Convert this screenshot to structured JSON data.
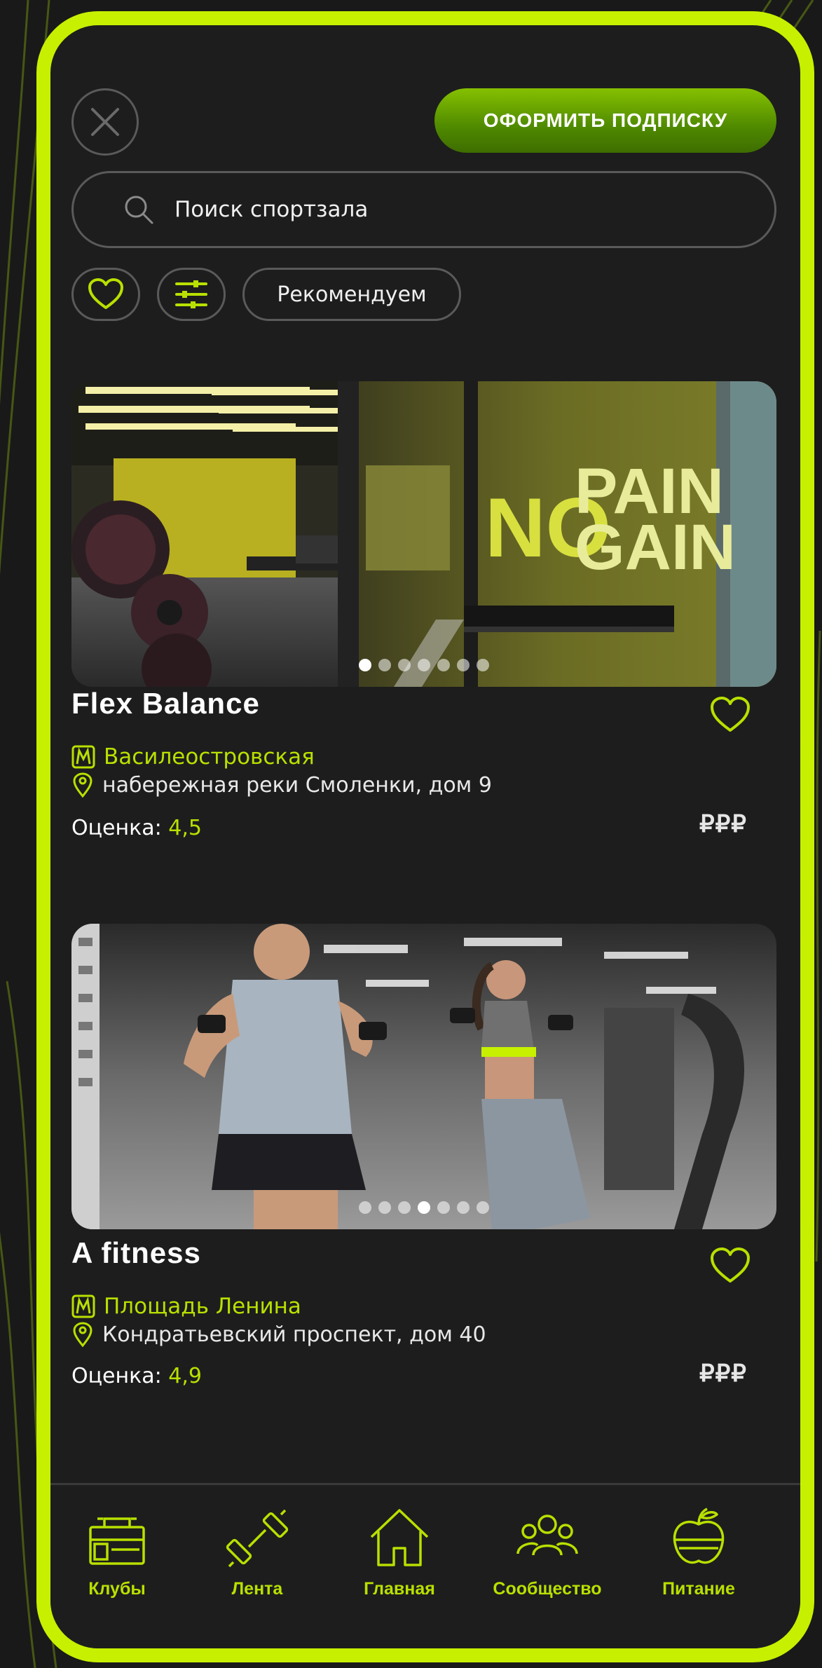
{
  "colors": {
    "accent": "#c6f000",
    "accent_text": "#b8e000",
    "background": "#1d1d1d",
    "button_green": "#5a9a00"
  },
  "header": {
    "close_icon": "close-icon",
    "subscribe_label": "ОФОРМИТЬ ПОДПИСКУ"
  },
  "search": {
    "placeholder": "Поиск спортзала",
    "icon": "search-icon"
  },
  "filters": {
    "favorites_icon": "heart-icon",
    "settings_icon": "sliders-icon",
    "recommend_label": "Рекомендуем"
  },
  "cards": [
    {
      "title": "Flex Balance",
      "metro": "Василеостровская",
      "address": "набережная реки Смоленки, дом 9",
      "rating_label": "Оценка:",
      "rating_value": "4,5",
      "price": "₽₽₽",
      "image_text": {
        "line1": "PAIN",
        "line2": "GAIN",
        "big": "NO"
      },
      "dots_total": 7,
      "dots_active": 1
    },
    {
      "title": "A fitness",
      "metro": "Площадь Ленина",
      "address": "Кондратьевский проспект, дом 40",
      "rating_label": "Оценка:",
      "rating_value": "4,9",
      "price": "₽₽₽",
      "dots_total": 7,
      "dots_active": 4
    }
  ],
  "nav": {
    "items": [
      {
        "label": "Клубы",
        "icon": "clubs-icon"
      },
      {
        "label": "Лента",
        "icon": "dumbbell-icon"
      },
      {
        "label": "Главная",
        "icon": "home-icon"
      },
      {
        "label": "Сообщество",
        "icon": "community-icon"
      },
      {
        "label": "Питание",
        "icon": "apple-icon"
      }
    ]
  }
}
